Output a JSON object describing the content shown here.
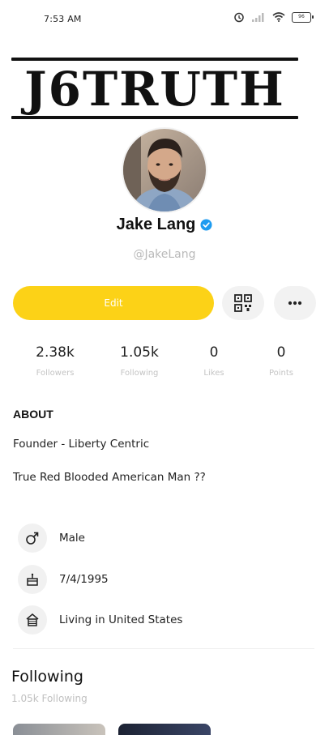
{
  "status_bar": {
    "time": "7:53 AM",
    "battery": "96"
  },
  "banner": {
    "text": "J6TRUTH"
  },
  "profile": {
    "name": "Jake Lang",
    "username": "@JakeLang",
    "verified": true
  },
  "actions": {
    "edit_label": "Edit",
    "qr_icon": "qr-code-icon",
    "more_icon": "more-dots-icon"
  },
  "stats": [
    {
      "value": "2.38k",
      "label": "Followers"
    },
    {
      "value": "1.05k",
      "label": "Following"
    },
    {
      "value": "0",
      "label": "Likes"
    },
    {
      "value": "0",
      "label": "Points"
    }
  ],
  "about": {
    "heading": "ABOUT",
    "lines": [
      "Founder - Liberty Centric",
      "True Red Blooded American Man ??"
    ]
  },
  "info": {
    "gender": "Male",
    "birthday": "7/4/1995",
    "location": "Living in United States"
  },
  "following": {
    "heading": "Following",
    "count_label": "1.05k Following"
  },
  "colors": {
    "accent": "#fcd217",
    "verified": "#1d9bf0",
    "muted_text": "#c4c4c4"
  }
}
